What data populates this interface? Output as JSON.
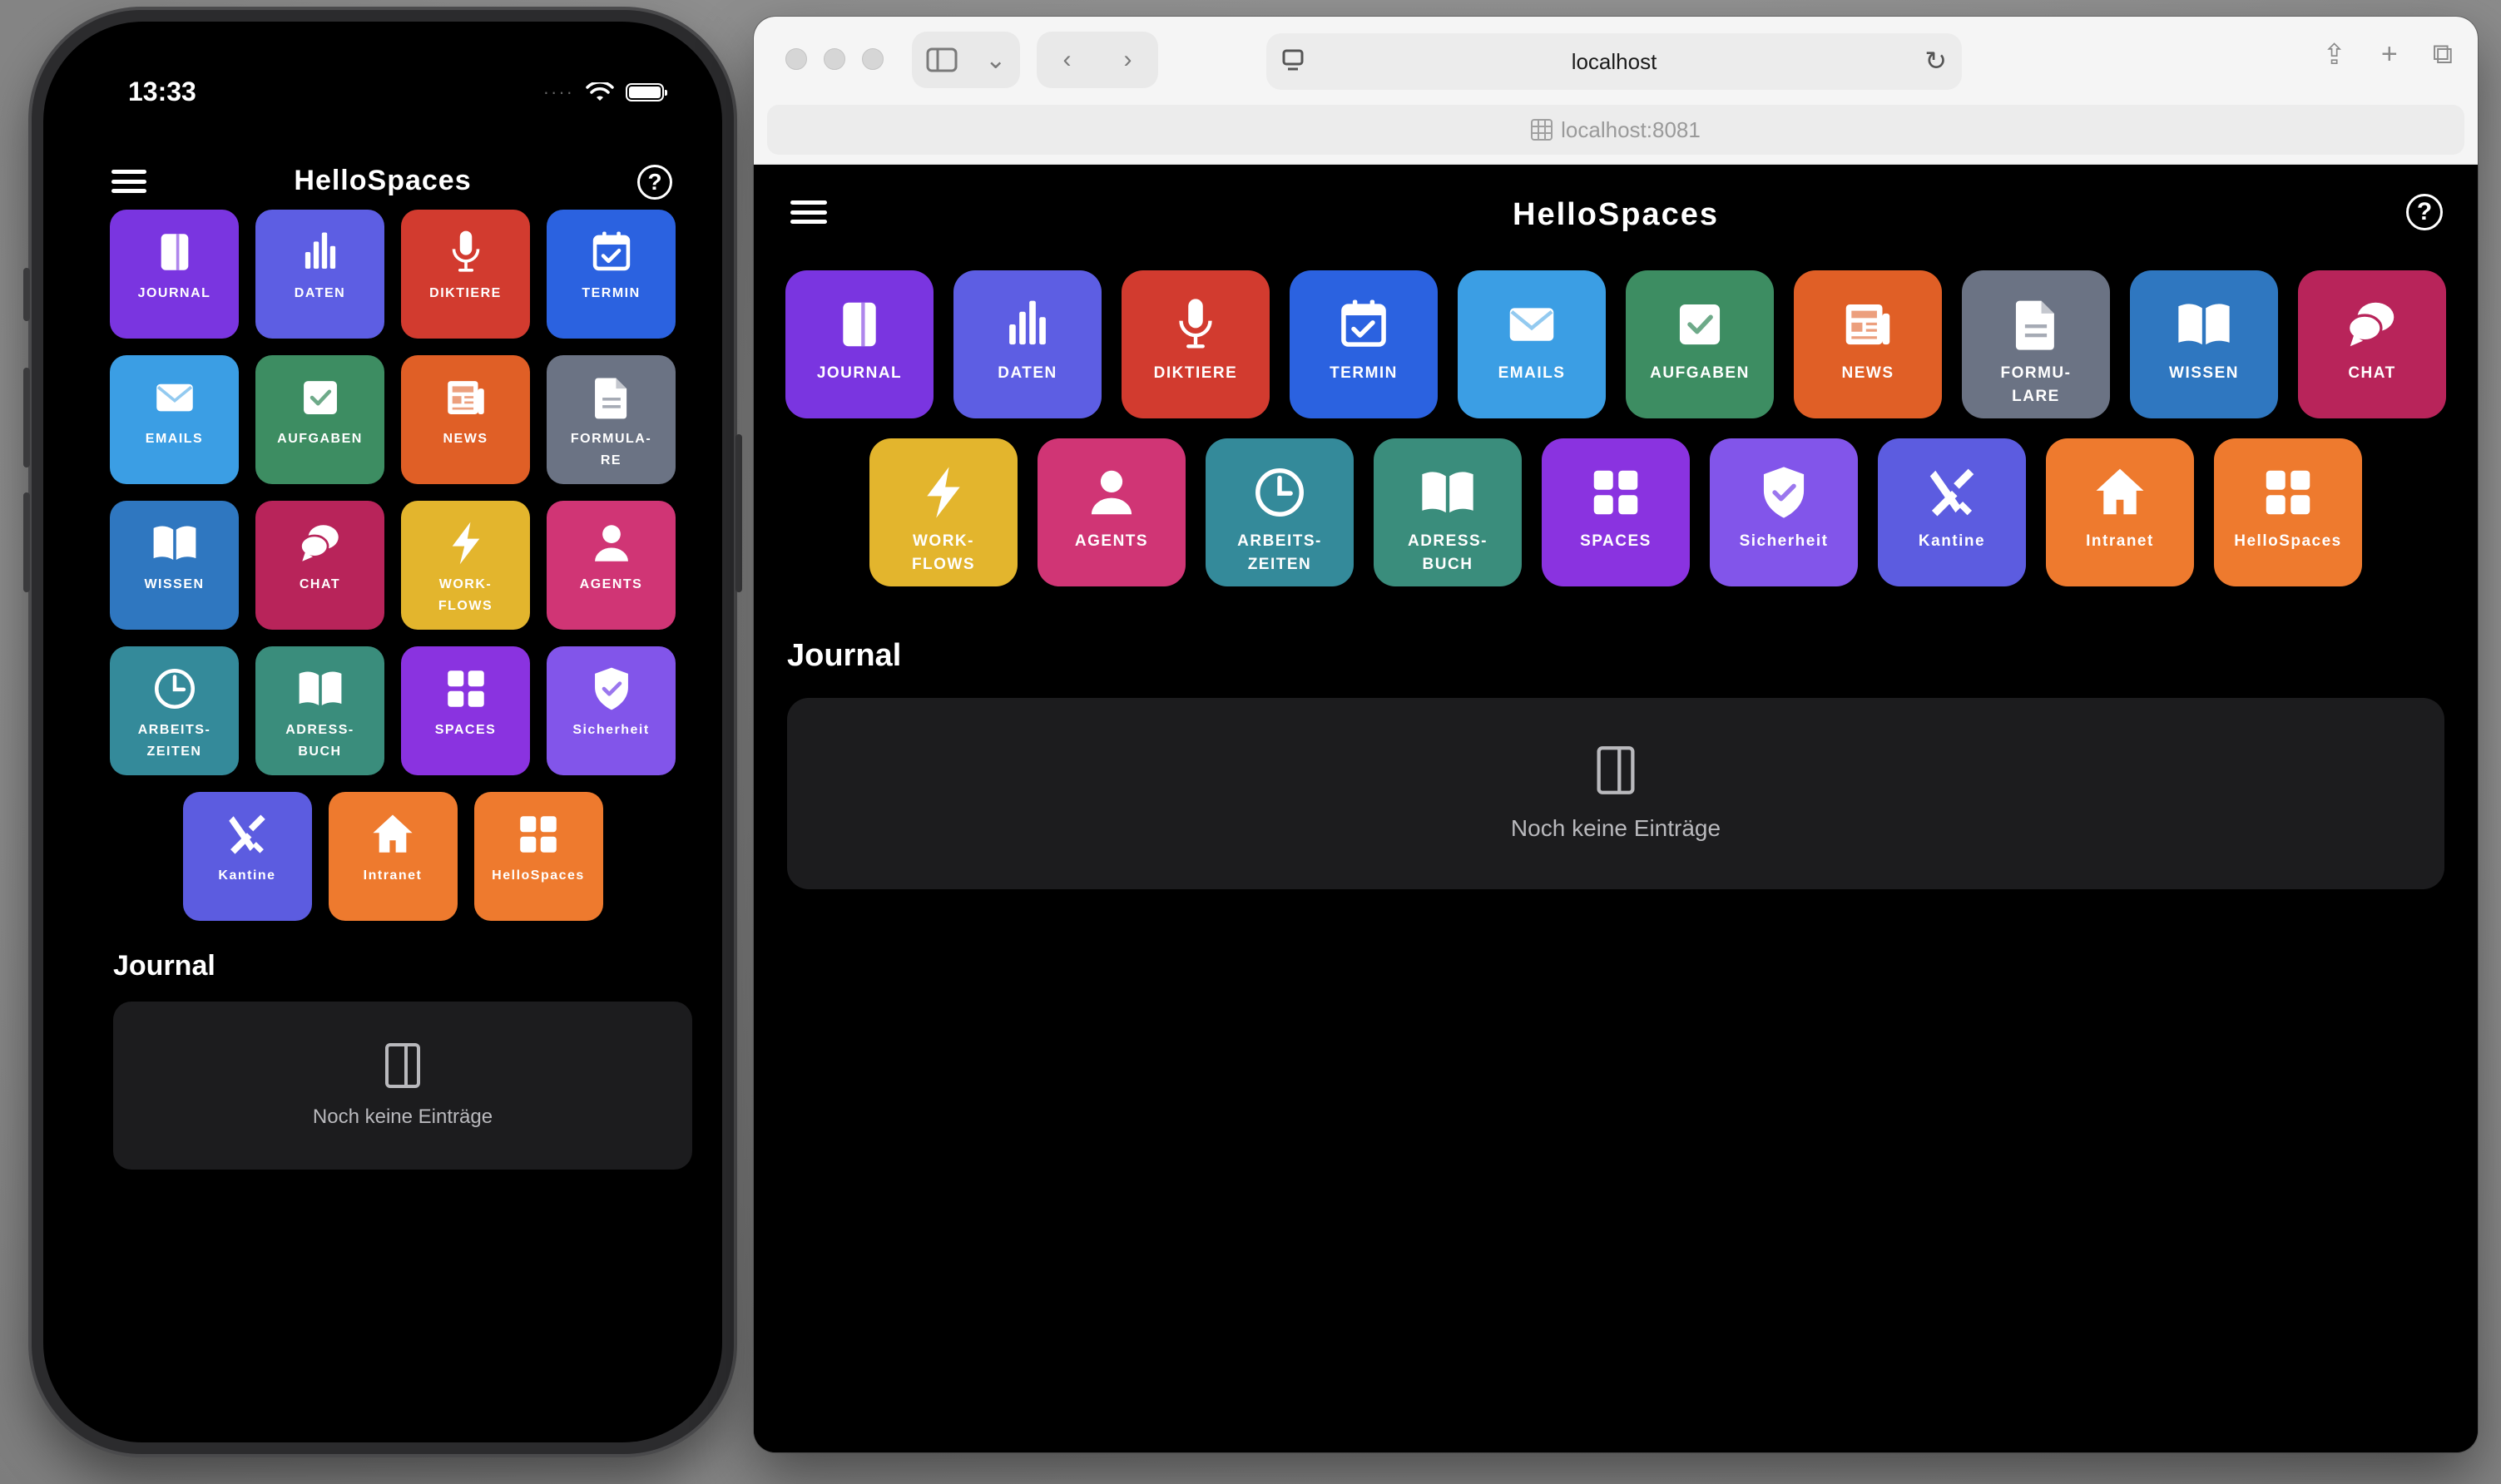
{
  "app": {
    "title": "HelloSpaces"
  },
  "phone": {
    "status": {
      "time": "13:33",
      "dots": "····"
    },
    "section_title": "Journal",
    "empty_text": "Noch keine Einträge"
  },
  "browser": {
    "tab_title": "localhost",
    "address": "localhost:8081",
    "section_title": "Journal",
    "empty_text": "Noch keine Einträge"
  },
  "mobile_tiles": [
    {
      "label": "JOURNAL",
      "icon": "journal-icon",
      "color": "#7a35e0"
    },
    {
      "label": "DATEN",
      "icon": "chart-icon",
      "color": "#5d5ee3"
    },
    {
      "label": "DIKTIERE",
      "icon": "microphone-icon",
      "color": "#d23b2f"
    },
    {
      "label": "TERMIN",
      "icon": "calendar-icon",
      "color": "#2b62e0"
    },
    {
      "label": "EMAILS",
      "icon": "mail-icon",
      "color": "#3b9ee4"
    },
    {
      "label": "AUFGABEN",
      "icon": "checkbox-icon",
      "color": "#3d8d62"
    },
    {
      "label": "NEWS",
      "icon": "newspaper-icon",
      "color": "#e05f26"
    },
    {
      "label": "FORMULA-\nRE",
      "icon": "document-icon",
      "color": "#6b7384"
    },
    {
      "label": "WISSEN",
      "icon": "book-icon",
      "color": "#2f77c0"
    },
    {
      "label": "CHAT",
      "icon": "chat-icon",
      "color": "#b8245a"
    },
    {
      "label": "WORK-\nFLOWS",
      "icon": "bolt-icon",
      "color": "#e3b52d"
    },
    {
      "label": "AGENTS",
      "icon": "user-icon",
      "color": "#d03575"
    },
    {
      "label": "ARBEITS-\nZEITEN",
      "icon": "clock-icon",
      "color": "#348a9a"
    },
    {
      "label": "ADRESS-\nBUCH",
      "icon": "address-book-icon",
      "color": "#3a8d7c"
    },
    {
      "label": "SPACES",
      "icon": "grid-icon",
      "color": "#8a33e0"
    },
    {
      "label": "Sicherheit",
      "icon": "shield-icon",
      "color": "#8255ea"
    },
    {
      "label": "Kantine",
      "icon": "cutlery-icon",
      "color": "#5c5ce0"
    },
    {
      "label": "Intranet",
      "icon": "home-icon",
      "color": "#ee7a2e"
    },
    {
      "label": "HelloSpaces",
      "icon": "grid-icon",
      "color": "#ee7a2e"
    }
  ],
  "web_tiles": [
    {
      "label": "JOURNAL",
      "icon": "journal-icon",
      "color": "#7a35e0"
    },
    {
      "label": "DATEN",
      "icon": "chart-icon",
      "color": "#5d5ee3"
    },
    {
      "label": "DIKTIERE",
      "icon": "microphone-icon",
      "color": "#d23b2f"
    },
    {
      "label": "TERMIN",
      "icon": "calendar-icon",
      "color": "#2b62e0"
    },
    {
      "label": "EMAILS",
      "icon": "mail-icon",
      "color": "#3b9ee4"
    },
    {
      "label": "AUFGABEN",
      "icon": "checkbox-icon",
      "color": "#3d8d62"
    },
    {
      "label": "NEWS",
      "icon": "newspaper-icon",
      "color": "#e05f26"
    },
    {
      "label": "FORMU-\nLARE",
      "icon": "document-icon",
      "color": "#6b7384"
    },
    {
      "label": "WISSEN",
      "icon": "book-icon",
      "color": "#2f77c0"
    },
    {
      "label": "CHAT",
      "icon": "chat-icon",
      "color": "#b8245a"
    },
    {
      "label": "WORK-\nFLOWS",
      "icon": "bolt-icon",
      "color": "#e3b52d"
    },
    {
      "label": "AGENTS",
      "icon": "user-icon",
      "color": "#d03575"
    },
    {
      "label": "ARBEITS-\nZEITEN",
      "icon": "clock-icon",
      "color": "#348a9a"
    },
    {
      "label": "ADRESS-\nBUCH",
      "icon": "address-book-icon",
      "color": "#3a8d7c"
    },
    {
      "label": "SPACES",
      "icon": "grid-icon",
      "color": "#8a33e0"
    },
    {
      "label": "Sicherheit",
      "icon": "shield-icon",
      "color": "#8255ea"
    },
    {
      "label": "Kantine",
      "icon": "cutlery-icon",
      "color": "#5c5ce0"
    },
    {
      "label": "Intranet",
      "icon": "home-icon",
      "color": "#ee7a2e"
    },
    {
      "label": "HelloSpaces",
      "icon": "grid-icon",
      "color": "#ee7a2e"
    }
  ]
}
